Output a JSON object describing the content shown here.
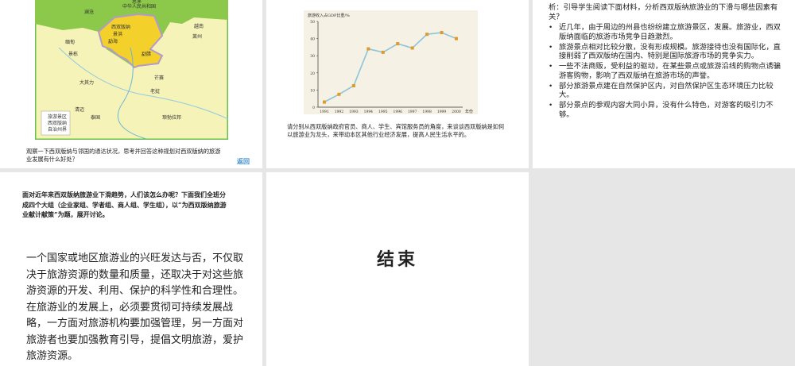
{
  "slide1": {
    "map_labels": {
      "china": "中华人民共和国",
      "xsbn": "西双版纳",
      "simao": "思茅",
      "lancang": "澜沧",
      "jinghong": "景洪",
      "menghai": "勐海",
      "mengla": "勐腊",
      "myanmar": "缅甸",
      "laos": "老挝",
      "thailand": "泰国",
      "vietnam": "越南",
      "daqili": "大其力",
      "qingmai": "清迈",
      "langbo": "琅勃拉邦",
      "mangxi": "芒赛",
      "laizhou": "莱州",
      "jingdong": "景栋"
    },
    "legend": [
      "旅游景区",
      "西双版纳",
      "自治州界"
    ],
    "caption": "观察一下西双版纳与邻国的通达状况，思考并回答这种规划对西双版纳的旅游业发展有什么好处？",
    "back_label": "返回"
  },
  "slide2": {
    "caption": "请分别从西双版纳政府官员、商人、学生、宾馆服务员的角度，来谈谈西双版纳是如何以旅游业为龙头，来带动本区其他行业经济发展，提高人民生活水平的。"
  },
  "chart_data": {
    "type": "line",
    "title": "",
    "ylabel": "旅游收入占GDP比重/%",
    "xlabel": "年份",
    "categories": [
      "1991",
      "1992",
      "1993",
      "1994",
      "1995",
      "1996",
      "1997",
      "1998",
      "1999",
      "2000"
    ],
    "values": [
      3,
      7.5,
      12.5,
      34,
      32,
      37,
      34.5,
      42.5,
      43.5,
      40
    ],
    "ylim": [
      0,
      50
    ],
    "yticks": [
      "0",
      "10",
      "20",
      "30",
      "40",
      "50"
    ],
    "colors": {
      "line": "#8cc4dc",
      "marker": "#e09a2a"
    }
  },
  "slide3": {
    "intro": "析：引导学生阅读下面材料，分析西双版纳旅游业的下滑与哪些因素有关？",
    "bullets": [
      "近几年，由于周边的州县也纷纷建立旅游景区，发展。旅游业，西双版纳面临的旅游市场竞争日趋激烈。",
      "旅游景点相对比较分散，没有形成规模。旅游接待也没有国际化，直接削弱了西双版纳在国内、特别是国际旅游市场的竞争实力。",
      "一些不法商贩，受利益的驱动，在某些景点或旅游沿线的购物点诱骗游客购物，影响了西双版纳在旅游市场的声誉。",
      "部分旅游景点建在自然保护区内，对自然保护区生态环境压力比较大。",
      "部分景点的参观内容大同小异，没有什么特色，对游客的吸引力不够。"
    ]
  },
  "slide4": {
    "question": "面对近年来西双版纳旅游业下滑趋势，人们该怎么办呢？下面我们全班分成四个大组（企业家组、学者组、商人组、学生组），以“为西双版纳旅游业献计献策”为题，展开讨论。",
    "summary": "一个国家或地区旅游业的兴旺发达与否，不仅取决于旅游资源的数量和质量，还取决于对这些旅游资源的开发、利用、保护的科学性和合理性。在旅游业的发展上，必须要贯彻可持续发展战略，一方面对旅游机构要加强管理，另一方面对旅游者也要加强教育引导，提倡文明旅游，爱护旅游资源。"
  },
  "slide5": {
    "title": "结束"
  }
}
